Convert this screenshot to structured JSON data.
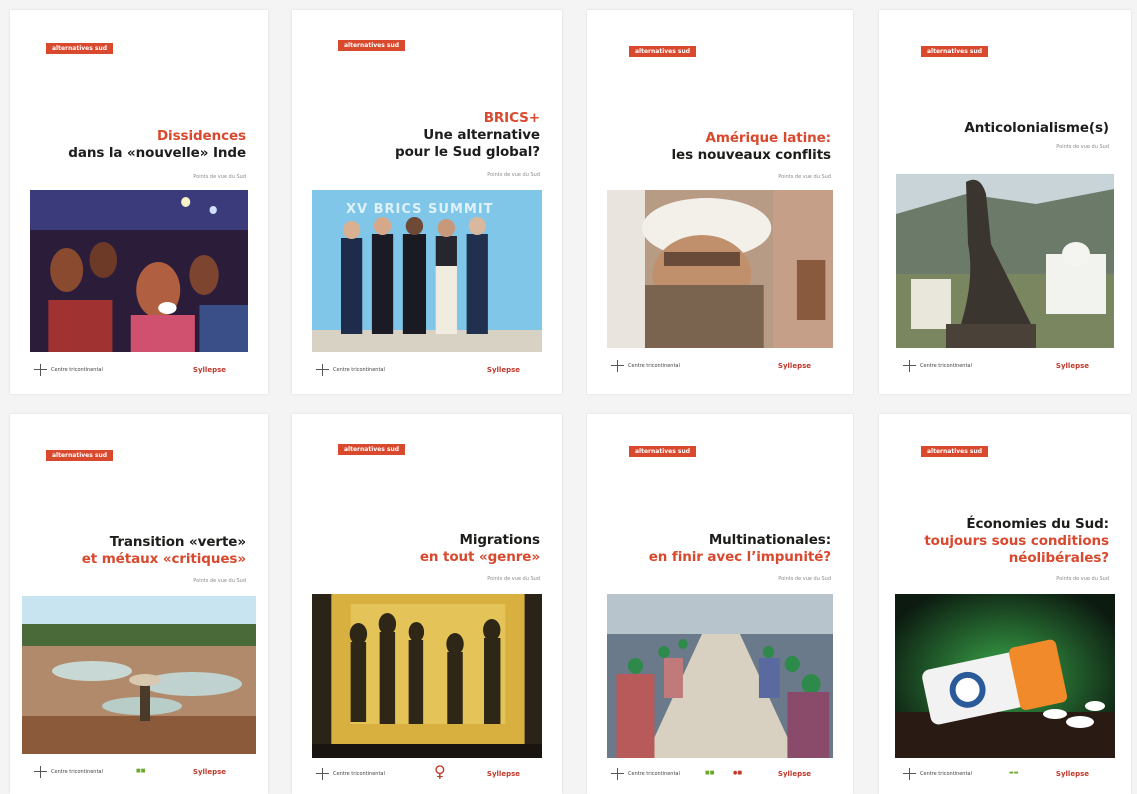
{
  "colors": {
    "accent": "#d9492e",
    "title_dark": "#1d1d1b",
    "subtitle": "#8a8a8a"
  },
  "covers": [
    {
      "badge": "alternatives sud",
      "title_lines": [
        {
          "text": "Dissidences",
          "color": "red"
        },
        {
          "text": "dans la «nouvelle» Inde",
          "color": "dark"
        }
      ],
      "subtitle": "Points de vue du Sud",
      "photo": "crowd-protest-image",
      "publisher": "Centre tricontinental",
      "partner": "Syllepse"
    },
    {
      "badge": "alternatives sud",
      "title_lines": [
        {
          "text": "BRICS+",
          "color": "red"
        },
        {
          "text": "Une alternative",
          "color": "dark"
        },
        {
          "text": "pour le Sud global?",
          "color": "dark"
        }
      ],
      "subtitle": "Points de vue du Sud",
      "photo": "brics-leaders-image",
      "photo_caption": "XV BRICS SUMMIT",
      "publisher": "Centre tricontinental",
      "partner": "Syllepse"
    },
    {
      "badge": "alternatives sud",
      "title_lines": [
        {
          "text": "Amérique latine:",
          "color": "red"
        },
        {
          "text": "les nouveaux conflits",
          "color": "dark"
        }
      ],
      "subtitle": "Points de vue du Sud",
      "photo": "masked-person-image",
      "publisher": "Centre tricontinental",
      "partner": "Syllepse"
    },
    {
      "badge": "alternatives sud",
      "title_lines": [
        {
          "text": "Anticolonialisme(s)",
          "color": "dark"
        }
      ],
      "subtitle": "Points de vue du Sud",
      "photo": "statue-palace-image",
      "publisher": "Centre tricontinental",
      "partner": "Syllepse"
    },
    {
      "badge": "alternatives sud",
      "title_lines": [
        {
          "text": "Transition «verte»",
          "color": "dark"
        },
        {
          "text": "et métaux «critiques»",
          "color": "red"
        }
      ],
      "subtitle": "Points de vue du Sud",
      "photo": "mining-landscape-image",
      "publisher": "Centre tricontinental",
      "partner": "Syllepse"
    },
    {
      "badge": "alternatives sud",
      "title_lines": [
        {
          "text": "Migrations",
          "color": "dark"
        },
        {
          "text": "en tout «genre»",
          "color": "red"
        }
      ],
      "subtitle": "Points de vue du Sud",
      "photo": "shadows-wall-image",
      "publisher": "Centre tricontinental",
      "partner": "Syllepse"
    },
    {
      "badge": "alternatives sud",
      "title_lines": [
        {
          "text": "Multinationales:",
          "color": "dark"
        },
        {
          "text": "en finir avec l’impunité?",
          "color": "red"
        }
      ],
      "subtitle": "Points de vue du Sud",
      "photo": "factory-workers-image",
      "publisher": "Centre tricontinental",
      "partner": "Syllepse"
    },
    {
      "badge": "alternatives sud",
      "title_lines": [
        {
          "text": "Économies du Sud:",
          "color": "dark"
        },
        {
          "text": "toujours sous conditions",
          "color": "red"
        },
        {
          "text": "néolibérales?",
          "color": "red"
        }
      ],
      "subtitle": "Points de vue du Sud",
      "photo": "imf-pill-bottle-image",
      "publisher": "Centre tricontinental",
      "partner": "Syllepse"
    }
  ]
}
